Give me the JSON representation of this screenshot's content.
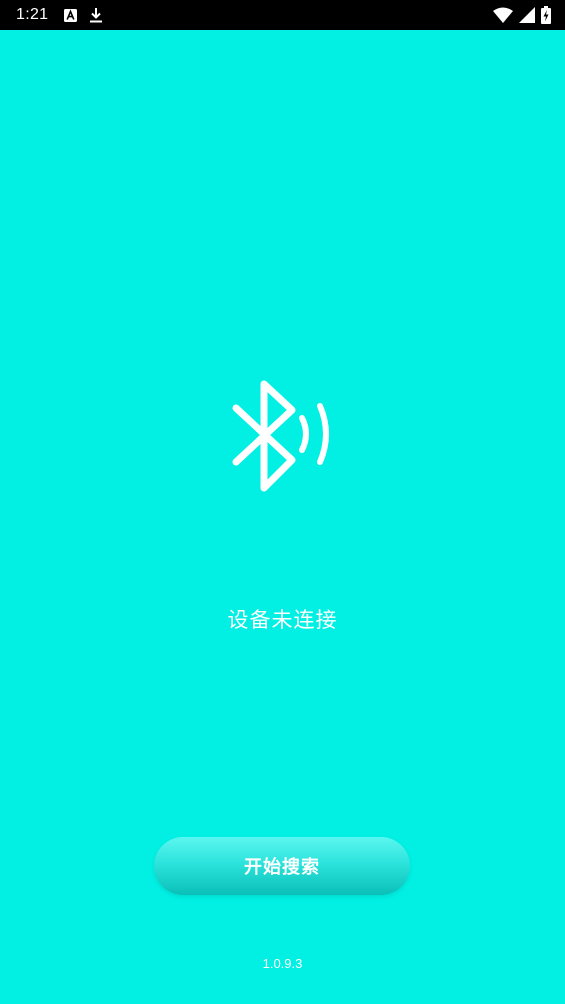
{
  "status_bar": {
    "time": "1:21",
    "left_icons": [
      "font-a-icon",
      "download-icon"
    ],
    "right_icons": [
      "wifi-icon",
      "signal-icon",
      "battery-charging-icon"
    ]
  },
  "main": {
    "icon": "bluetooth-searching-icon",
    "status_text": "设备未连接",
    "search_button_label": "开始搜索",
    "version": "1.0.9.3"
  },
  "colors": {
    "background": "#02F0E4",
    "status_bar": "#000000",
    "text": "#FFFFFF"
  }
}
